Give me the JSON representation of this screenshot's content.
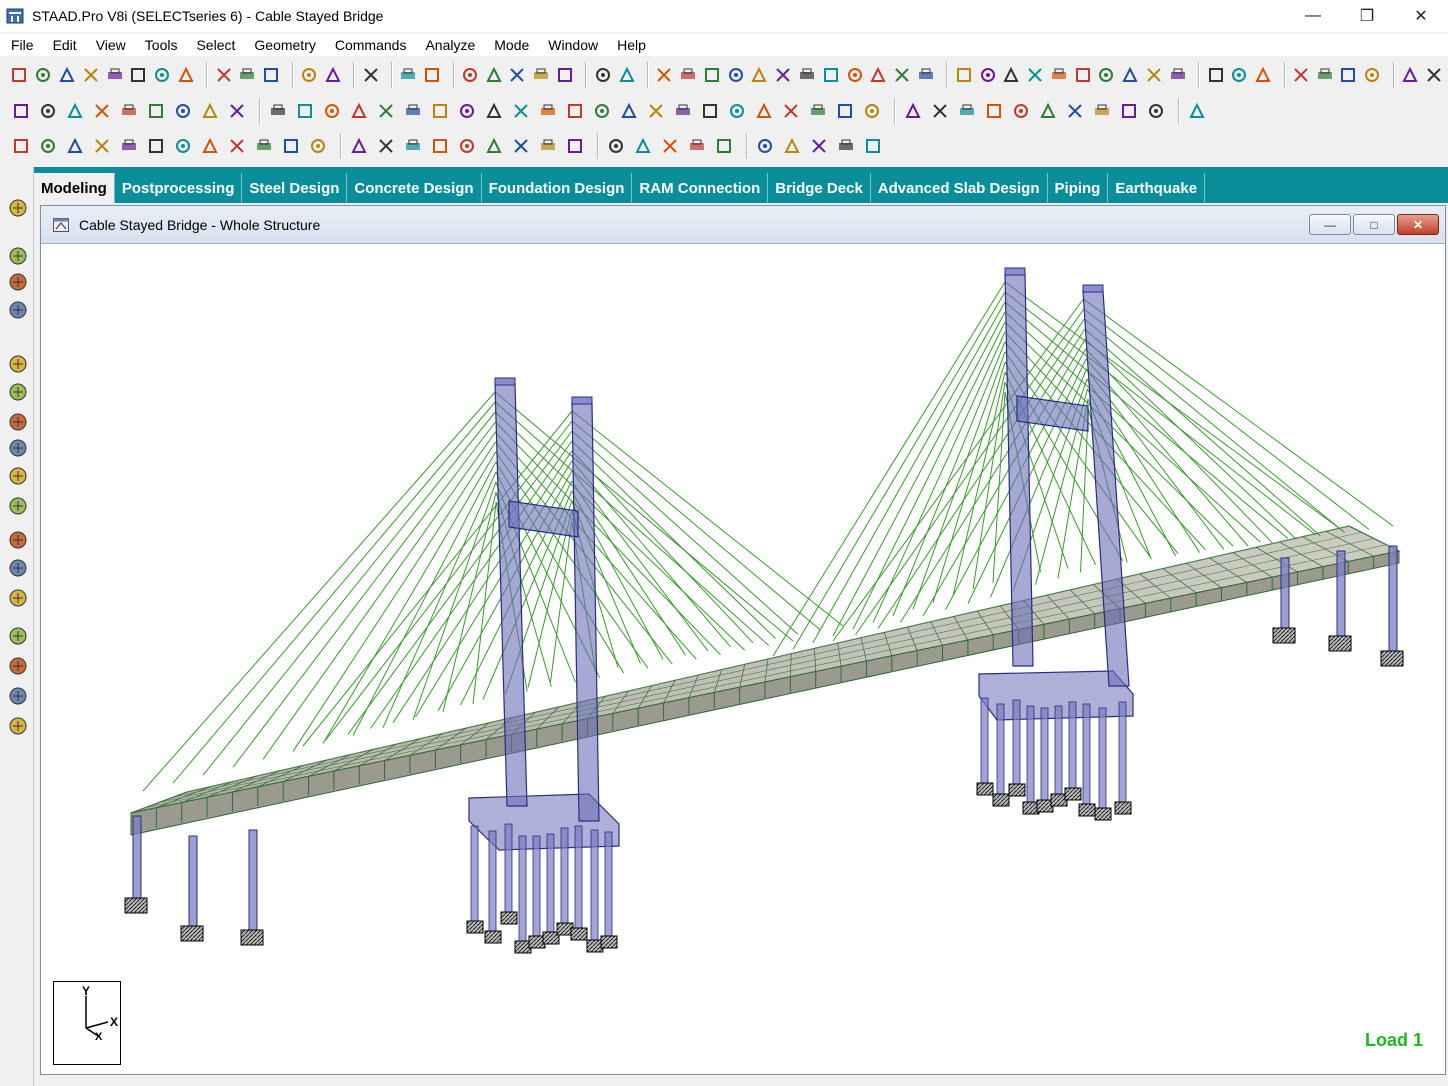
{
  "app": {
    "title": "STAAD.Pro V8i (SELECTseries 6) - Cable Stayed Bridge",
    "window_controls": [
      "minimize-icon",
      "restore-icon",
      "close-icon"
    ]
  },
  "menu": {
    "items": [
      "File",
      "Edit",
      "View",
      "Tools",
      "Select",
      "Geometry",
      "Commands",
      "Analyze",
      "Mode",
      "Window",
      "Help"
    ]
  },
  "tabs": {
    "items": [
      "Modeling",
      "Postprocessing",
      "Steel Design",
      "Concrete Design",
      "Foundation Design",
      "RAM Connection",
      "Bridge Deck",
      "Advanced Slab Design",
      "Piping",
      "Earthquake"
    ],
    "active": "Modeling"
  },
  "document": {
    "title": "Cable Stayed Bridge - Whole Structure",
    "load_label": "Load 1",
    "axis": {
      "y": "Y",
      "x": "X",
      "z": "X"
    }
  },
  "colors": {
    "tab_bar": "#0a8f9a",
    "cable": "#3a9a2c",
    "pylon": "#4a4fa8",
    "deck": "#8a8a80",
    "load_label": "#1db81d"
  }
}
